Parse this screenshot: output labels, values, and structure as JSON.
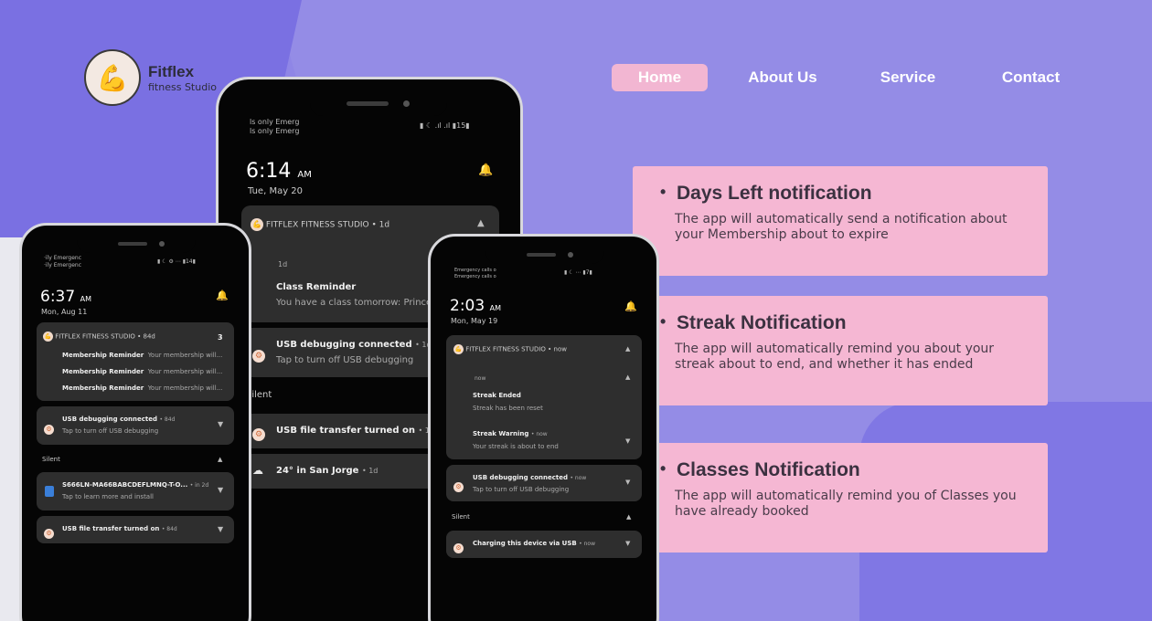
{
  "logo": {
    "name": "Fitflex",
    "sub": "fitness Studio",
    "icon": "flexed-arm-icon"
  },
  "nav": {
    "home": "Home",
    "about": "About Us",
    "service": "Service",
    "contact": "Contact"
  },
  "cards": [
    {
      "title": "Days Left notification",
      "text": "The app will automatically send a notification about your Membership about to expire"
    },
    {
      "title": "Streak Notification",
      "text": "The app will automatically remind you about your streak about to end, and whether it has ended"
    },
    {
      "title": "Classes Notification",
      "text": "The app will automatically remind you of Classes you have already booked"
    }
  ],
  "phone1": {
    "status_l1": "·ily    Emergenc",
    "status_l2": "·ily    Emergenc",
    "status_r": "▮ ☾ ⚙ ⋯ ▮14▮",
    "time": "6:37",
    "ampm": "AM",
    "date": "Mon, Aug 11",
    "app": "FITFLEX FITNESS STUDIO",
    "app_meta": "• 84d",
    "count": "3",
    "reminders": [
      {
        "title": "Membership Reminder",
        "body": "Your membership will..."
      },
      {
        "title": "Membership Reminder",
        "body": "Your membership will..."
      },
      {
        "title": "Membership Reminder",
        "body": "Your membership will..."
      }
    ],
    "usb_title": "USB debugging connected",
    "usb_meta": "• 84d",
    "usb_body": "Tap to turn off USB debugging",
    "silent": "Silent",
    "sm_title": "S666LN-MA66BABCDEFLMNQ-T-O...",
    "sm_meta": "• in 2d",
    "sm_body": "Tap to learn more and install",
    "file_title": "USB file transfer turned on",
    "file_meta": "• 84d"
  },
  "phone2": {
    "status_l1": "ls only      Emerg",
    "status_l2": "ls only      Emerg",
    "status_r": "▮ ☾ .ıl .ıl ▮15▮",
    "time": "6:14",
    "ampm": "AM",
    "date": "Tue, May 20",
    "app": "FITFLEX FITNESS STUDIO",
    "app_meta": "• 1d",
    "sub_meta": "1d",
    "cr_title": "Class Reminder",
    "cr_body": "You have a class tomorrow: Prince",
    "usb_title": "USB debugging connected",
    "usb_meta": "• 1d",
    "usb_body": "Tap to turn off USB debugging",
    "silent": "Silent",
    "file_title": "USB file transfer turned on",
    "file_meta": "• 1d",
    "weather_title": "24° in San Jorge",
    "weather_meta": "• 1d"
  },
  "phone3": {
    "status_l1": "Emergency calls o",
    "status_l2": "Emergency calls o",
    "status_r": "▮ ☾ ⋯ ▮7▮",
    "time": "2:03",
    "ampm": "AM",
    "date": "Mon, May 19",
    "app": "FITFLEX FITNESS STUDIO",
    "app_meta": "• now",
    "sub_meta": "now",
    "se_title": "Streak Ended",
    "se_body": "Streak has been reset",
    "sw_title": "Streak Warning",
    "sw_meta": "• now",
    "sw_body": "Your streak is about to end",
    "usb_title": "USB debugging connected",
    "usb_meta": "• now",
    "usb_body": "Tap to turn off USB debugging",
    "silent": "Silent",
    "charge_title": "Charging this device via USB",
    "charge_meta": "• now"
  }
}
